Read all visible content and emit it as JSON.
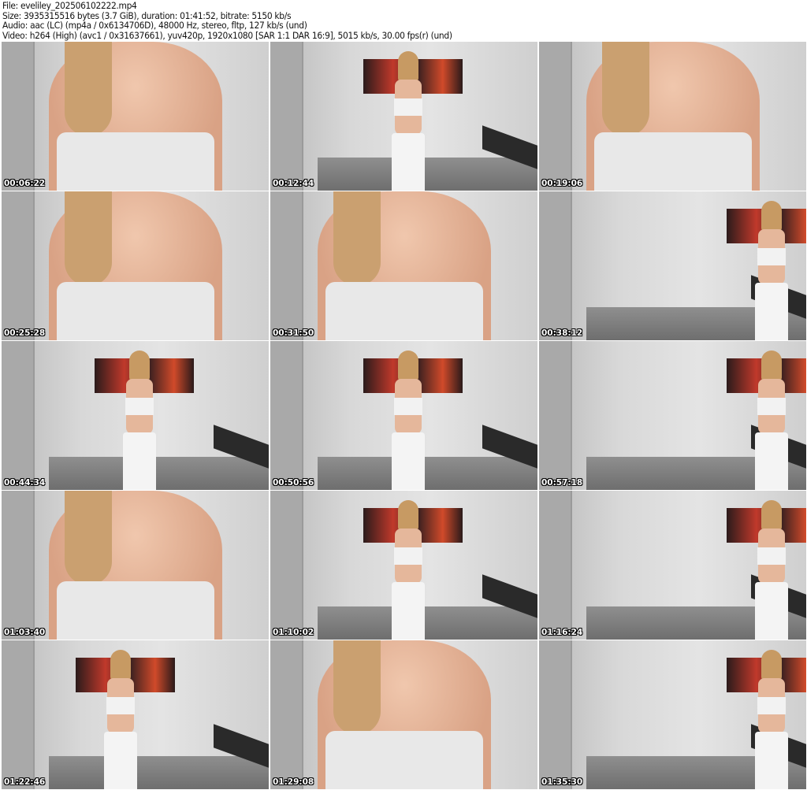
{
  "header": {
    "file": "File: eveliley_202506102222.mp4",
    "size": "Size: 3935315516 bytes (3.7 GiB), duration: 01:41:52, bitrate: 5150 kb/s",
    "audio": "Audio: aac (LC) (mp4a / 0x6134706D), 48000 Hz, stereo, fltp, 127 kb/s (und)",
    "video": "Video: h264 (High) (avc1 / 0x31637661), yuv420p, 1920x1080 [SAR 1:1 DAR 16:9], 5015 kb/s, 30.00 fps(r) (und)"
  },
  "thumbnails": [
    {
      "timestamp": "00:06:22"
    },
    {
      "timestamp": "00:12:44"
    },
    {
      "timestamp": "00:19:06"
    },
    {
      "timestamp": "00:25:28"
    },
    {
      "timestamp": "00:31:50"
    },
    {
      "timestamp": "00:38:12"
    },
    {
      "timestamp": "00:44:34"
    },
    {
      "timestamp": "00:50:56"
    },
    {
      "timestamp": "00:57:18"
    },
    {
      "timestamp": "01:03:40"
    },
    {
      "timestamp": "01:10:02"
    },
    {
      "timestamp": "01:16:24"
    },
    {
      "timestamp": "01:22:46"
    },
    {
      "timestamp": "01:29:08"
    },
    {
      "timestamp": "01:35:30"
    }
  ]
}
